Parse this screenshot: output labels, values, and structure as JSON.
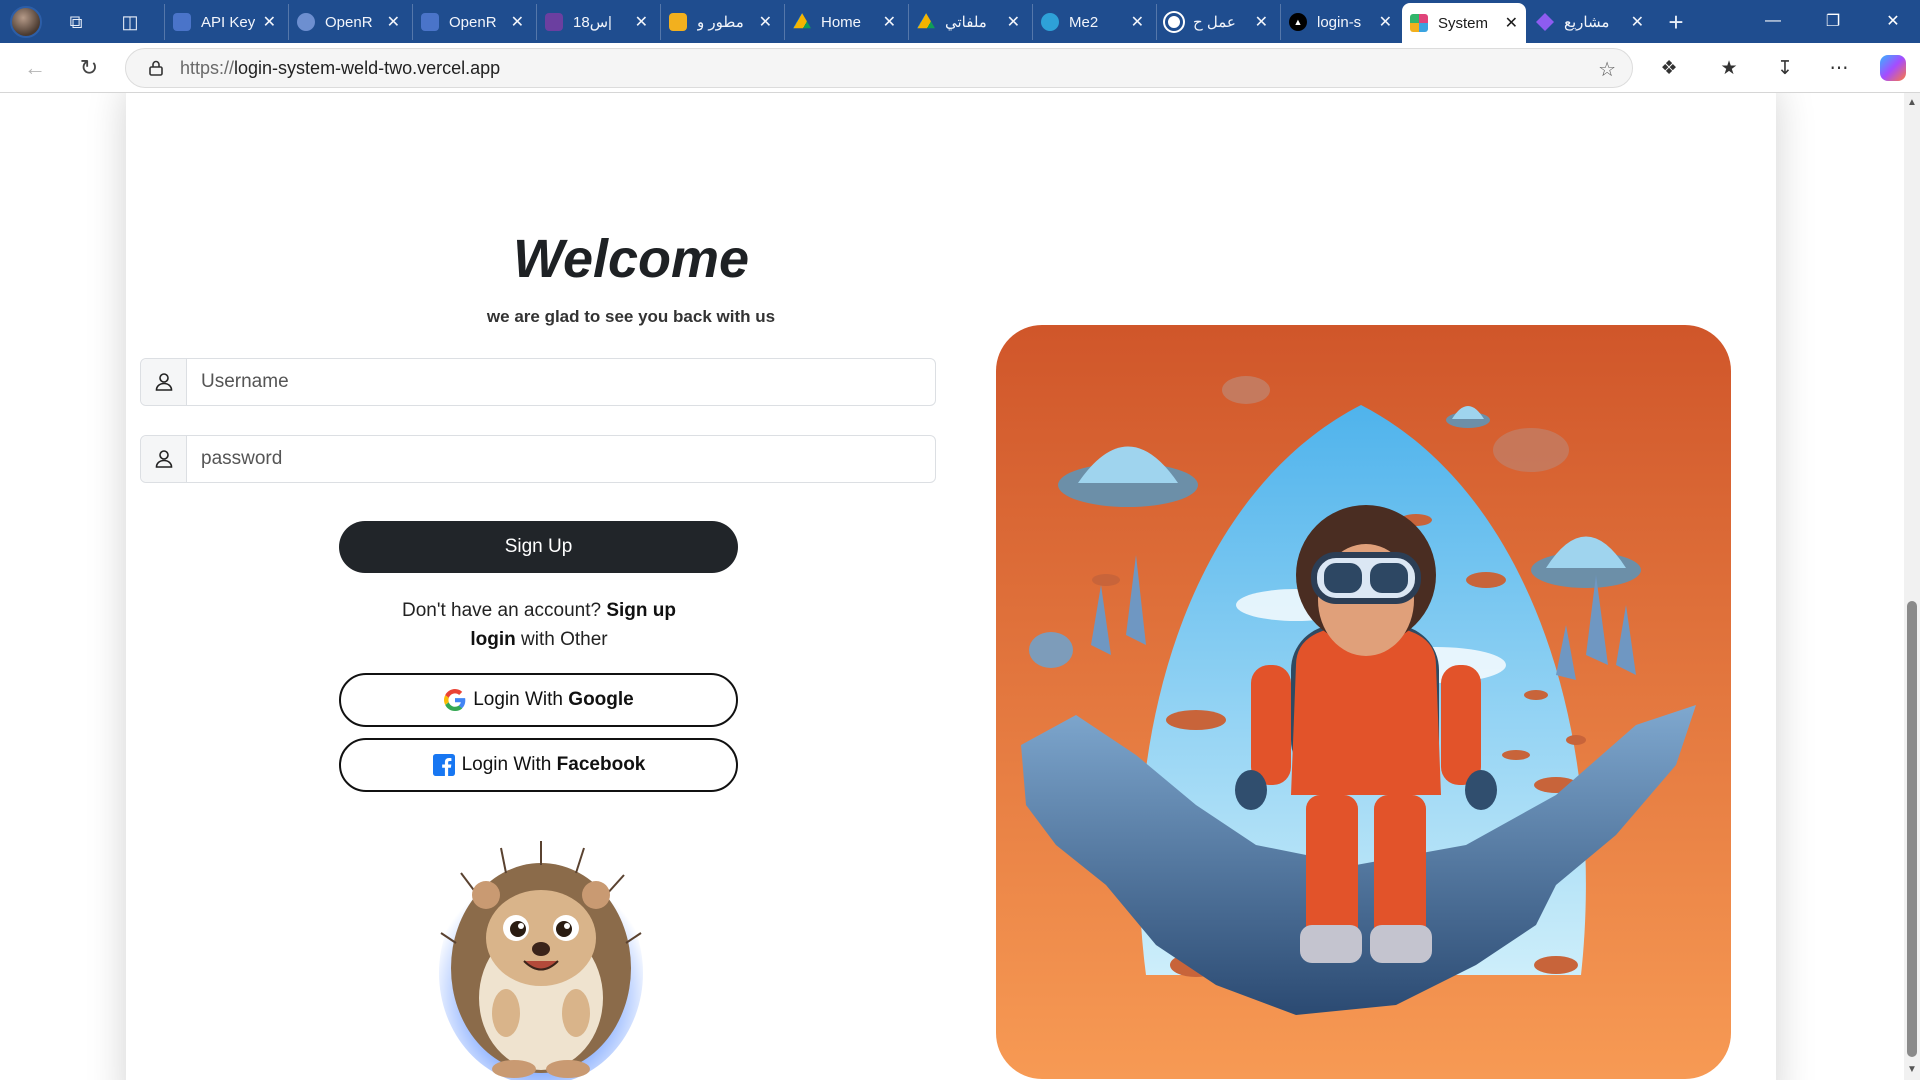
{
  "tabs": [
    {
      "title": "API Key",
      "favicon_color": "#4a74c9"
    },
    {
      "title": "OpenR",
      "favicon_color": "#6d8fd0"
    },
    {
      "title": "OpenR",
      "favicon_color": "#4a74c9"
    },
    {
      "title": "س18|",
      "favicon_color": "#6b3fa0"
    },
    {
      "title": "مطور و",
      "favicon_color": "#f2b01e"
    },
    {
      "title": "Home",
      "favicon_color": "#2f9e54"
    },
    {
      "title": "ملفاتي",
      "favicon_color": "#2f9e54"
    },
    {
      "title": "Me2",
      "favicon_color": "#2ea1d8"
    },
    {
      "title": "عمل ح",
      "favicon_color": "#ffffff"
    },
    {
      "title": "login-s",
      "favicon_color": "#000000"
    },
    {
      "title": "System",
      "favicon_color": "#e0447a",
      "active": true
    },
    {
      "title": "مشاريع",
      "favicon_color": "#8e5cf0"
    }
  ],
  "address_bar": {
    "scheme": "https://",
    "host": "login-system-weld-two.vercel.app"
  },
  "page": {
    "title": "Welcome",
    "subtitle": "we are glad to see you back with us",
    "username_placeholder": "Username",
    "password_placeholder": "password",
    "signup_button": "Sign Up",
    "no_account_text": "Don't have an account?",
    "signup_link": "Sign up",
    "login_link": "login",
    "with_other_text": "with Other",
    "google_button_prefix": "Login With",
    "google_button_brand": "Google",
    "facebook_button_prefix": "Login With",
    "facebook_button_brand": "Facebook"
  },
  "colors": {
    "tabstrip": "#1f4d8f",
    "primary_button": "#212529",
    "hero_orange": "#f08a3c",
    "hero_sky": "#6fc3ef"
  }
}
